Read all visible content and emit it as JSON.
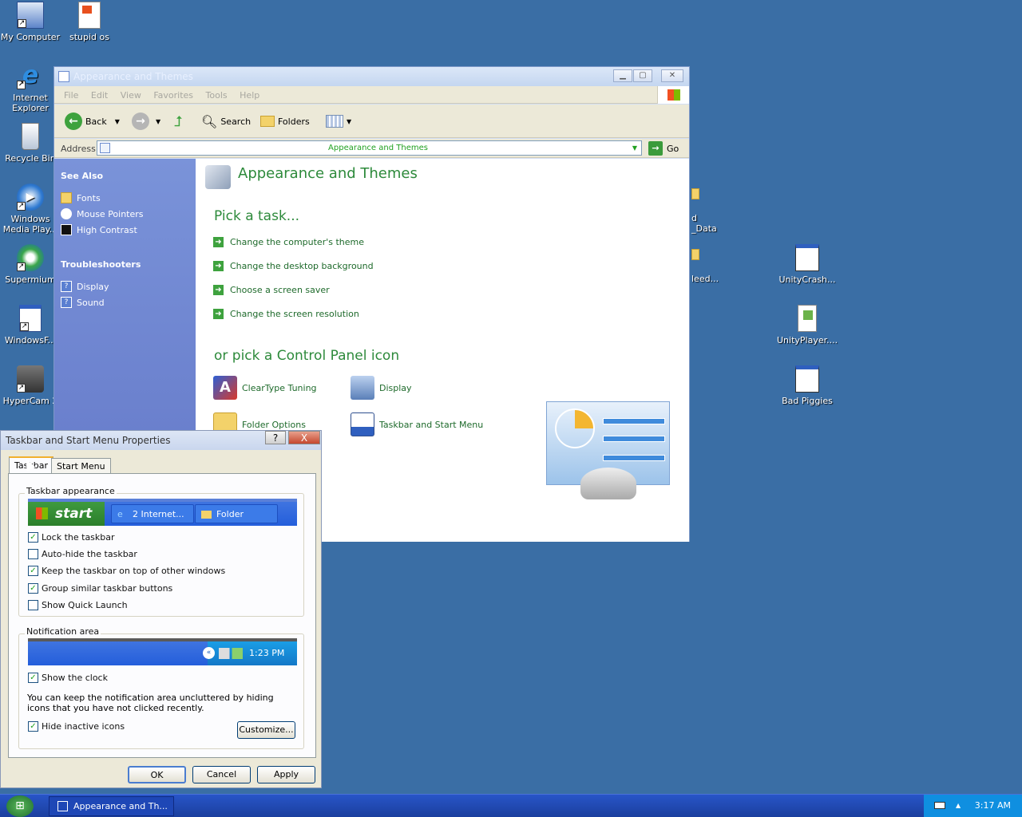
{
  "desktop": {
    "icons": [
      {
        "label": "My Computer",
        "icon": "my-computer-icon"
      },
      {
        "label": "stupid os",
        "icon": "document-icon"
      },
      {
        "label": "Internet Explorer",
        "icon": "internet-explorer-icon"
      },
      {
        "label": "Recycle Bin",
        "icon": "recycle-bin-icon"
      },
      {
        "label": "Windows Media Play...",
        "icon": "media-player-icon"
      },
      {
        "label": "Supermium",
        "icon": "supermium-icon"
      },
      {
        "label": "WindowsF...",
        "icon": "window-icon"
      },
      {
        "label": "HyperCam 2",
        "icon": "hypercam-icon"
      },
      {
        "label": "UnityCrash...",
        "icon": "window-icon"
      },
      {
        "label": "UnityPlayer....",
        "icon": "dll-icon"
      },
      {
        "label": "Bad Piggies",
        "icon": "window-icon"
      }
    ],
    "partial_labels": [
      "d",
      "_Data",
      "leed..."
    ]
  },
  "cp_window": {
    "title": "Appearance and Themes",
    "menu": [
      "File",
      "Edit",
      "View",
      "Favorites",
      "Tools",
      "Help"
    ],
    "toolbar": {
      "back": "Back",
      "search": "Search",
      "folders": "Folders"
    },
    "address_label": "Address",
    "address_value": "Appearance and Themes",
    "go_label": "Go",
    "see_also_heading": "See Also",
    "see_also": [
      "Fonts",
      "Mouse Pointers",
      "High Contrast"
    ],
    "troubleshooters_heading": "Troubleshooters",
    "troubleshooters": [
      "Display",
      "Sound"
    ],
    "heading": "Appearance and Themes",
    "pick_task": "Pick a task...",
    "tasks": [
      "Change the computer's theme",
      "Change the desktop background",
      "Choose a screen saver",
      "Change the screen resolution"
    ],
    "pick_icon": "or pick a Control Panel icon",
    "cp_icons": [
      "ClearType Tuning",
      "Display",
      "Folder Options",
      "Taskbar and Start Menu"
    ]
  },
  "dialog": {
    "title": "Taskbar and Start Menu Properties",
    "help_btn": "?",
    "close_btn": "X",
    "tabs": [
      "Taskbar",
      "Start Menu"
    ],
    "appearance_group": "Taskbar appearance",
    "preview_start": "start",
    "preview_btn1": "2 Internet...",
    "preview_btn2": "Folder",
    "options": [
      {
        "label": "Lock the taskbar",
        "checked": true
      },
      {
        "label": "Auto-hide the taskbar",
        "checked": false
      },
      {
        "label": "Keep the taskbar on top of other windows",
        "checked": true
      },
      {
        "label": "Group similar taskbar buttons",
        "checked": true
      },
      {
        "label": "Show Quick Launch",
        "checked": false
      }
    ],
    "notification_group": "Notification area",
    "preview_time": "1:23 PM",
    "show_clock": "Show the clock",
    "desc": "You can keep the notification area uncluttered by hiding icons that you have not clicked recently.",
    "hide_inactive": "Hide inactive icons",
    "customize": "Customize...",
    "ok": "OK",
    "cancel": "Cancel",
    "apply": "Apply"
  },
  "taskbar": {
    "task_label": "Appearance and Th...",
    "clock": "3:17 AM"
  }
}
